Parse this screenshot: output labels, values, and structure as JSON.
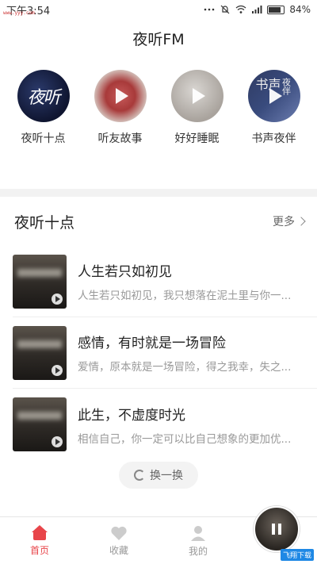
{
  "status_bar": {
    "time": "下午3:54",
    "battery": "84%",
    "watermark": "www.yyy.com"
  },
  "header": {
    "title": "夜听FM"
  },
  "categories": [
    {
      "label": "夜听十点",
      "glyph": "夜听"
    },
    {
      "label": "听友故事"
    },
    {
      "label": "好好睡眠"
    },
    {
      "label": "书声夜伴",
      "glyph": "书声",
      "glyph2": "夜伴"
    }
  ],
  "section": {
    "title": "夜听十点",
    "more": "更多"
  },
  "items": [
    {
      "title": "人生若只如初见",
      "desc": "人生若只如初见，我只想落在泥土里与你一..."
    },
    {
      "title": "感情，有时就是一场冒险",
      "desc": "爱情，原本就是一场冒险，得之我幸，失之..."
    },
    {
      "title": "此生，不虚度时光",
      "desc": "相信自己，你一定可以比自己想象的更加优..."
    }
  ],
  "refresh": {
    "label": "换一换"
  },
  "tabbar": {
    "home": "首页",
    "favorites": "收藏",
    "mine": "我的",
    "badge": "飞翔下载"
  }
}
